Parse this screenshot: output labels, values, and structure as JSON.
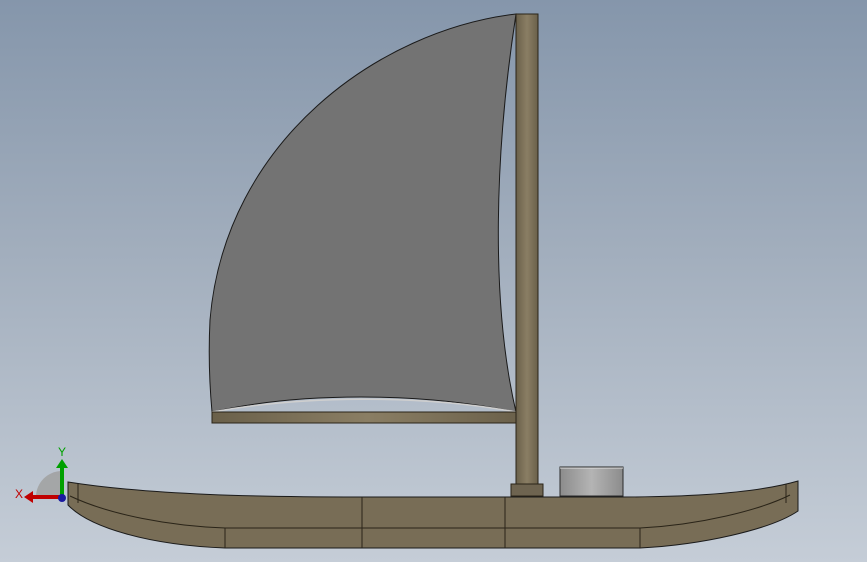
{
  "viewport": {
    "background_top": "#8596ab",
    "background_bottom": "#c5cdd7"
  },
  "model": {
    "parts": [
      "sail",
      "mast",
      "boom",
      "hull",
      "deck-box",
      "mast-base"
    ],
    "colors": {
      "sail": "#737373",
      "wood": "#786d56",
      "wood_dark": "#5a503c",
      "box": "#9a9a9a",
      "outline": "#1a1a1a"
    }
  },
  "triad": {
    "x_label": "X",
    "y_label": "Y",
    "x_color": "#c00000",
    "y_color": "#00a000",
    "z_color": "#1a1aa0",
    "icon": "coordinate-triad-icon"
  }
}
